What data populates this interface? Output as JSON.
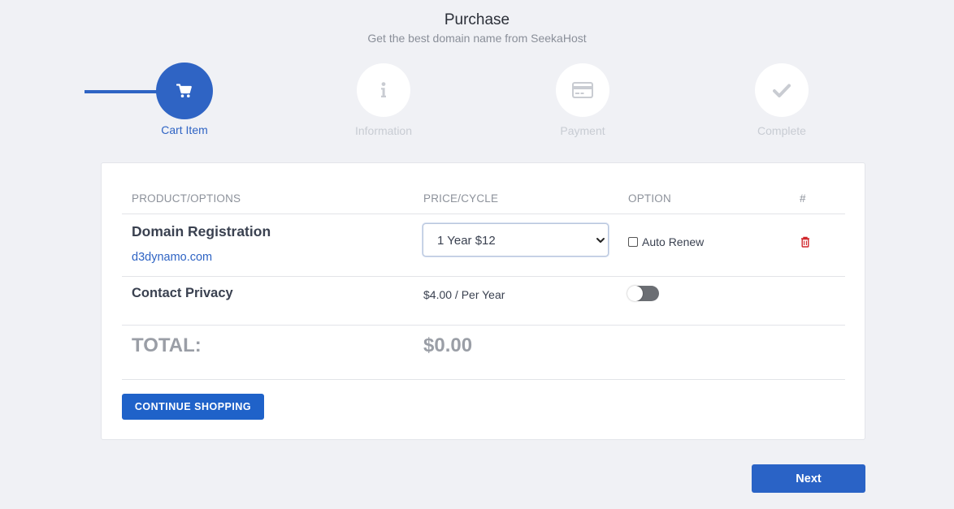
{
  "header": {
    "title": "Purchase",
    "subtitle": "Get the best domain name from SeekaHost"
  },
  "steps": [
    {
      "label": "Cart Item",
      "icon": "cart-icon",
      "active": true
    },
    {
      "label": "Information",
      "icon": "info-icon",
      "active": false
    },
    {
      "label": "Payment",
      "icon": "credit-card-icon",
      "active": false
    },
    {
      "label": "Complete",
      "icon": "check-icon",
      "active": false
    }
  ],
  "table": {
    "headers": [
      "PRODUCT/OPTIONS",
      "PRICE/CYCLE",
      "OPTION",
      "#"
    ],
    "rows": [
      {
        "product": "Domain Registration",
        "domain": "d3dynamo.com",
        "price_select": "1 Year $12",
        "option_label": "Auto Renew",
        "option_checked": false
      },
      {
        "product": "Contact Privacy",
        "price": "$4.00 / Per Year",
        "toggle_on": false
      }
    ],
    "total_label": "TOTAL:",
    "total_value": "$0.00"
  },
  "buttons": {
    "continue": "CONTINUE SHOPPING",
    "next": "Next"
  },
  "colors": {
    "accent": "#2f64c4",
    "danger": "#d0262b",
    "background": "#f0f1f5"
  }
}
